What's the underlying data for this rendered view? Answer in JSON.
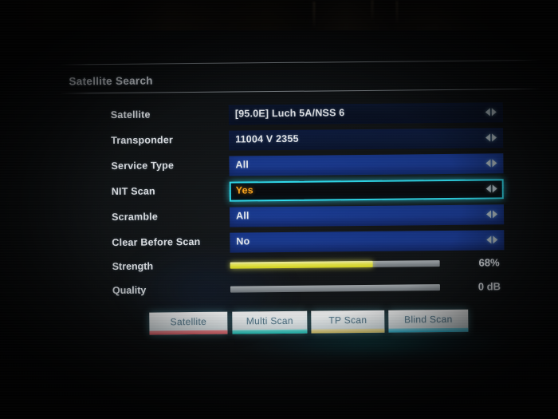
{
  "screen": {
    "title": "Satellite Search"
  },
  "fields": [
    {
      "label": "Satellite",
      "value": "[95.0E] Luch 5A/NSS 6",
      "selected": false,
      "shade": "dimmer"
    },
    {
      "label": "Transponder",
      "value": "11004 V 2355",
      "selected": false,
      "shade": "dim"
    },
    {
      "label": "Service Type",
      "value": "All",
      "selected": false,
      "shade": ""
    },
    {
      "label": "NIT Scan",
      "value": "Yes",
      "selected": true,
      "shade": ""
    },
    {
      "label": "Scramble",
      "value": "All",
      "selected": false,
      "shade": ""
    },
    {
      "label": "Clear Before Scan",
      "value": "No",
      "selected": false,
      "shade": ""
    }
  ],
  "meters": [
    {
      "label": "Strength",
      "value": "68%",
      "percent": 68
    },
    {
      "label": "Quality",
      "value": "0 dB",
      "percent": 0
    }
  ],
  "buttons": [
    {
      "label": "Satellite",
      "accent": "#f4626c"
    },
    {
      "label": "Multi Scan",
      "accent": "#1ad7cc"
    },
    {
      "label": "TP Scan",
      "accent": "#f2dd72"
    },
    {
      "label": "Blind Scan",
      "accent": "#2ec9ea"
    }
  ],
  "icons": {
    "left_arrow": "arrow-left-icon",
    "right_arrow": "arrow-right-icon"
  },
  "colors": {
    "field_blue": "#1a3a90",
    "highlight_border": "#31e0f2",
    "highlight_text": "#ffa81f",
    "meter_fill": "#f2f252",
    "meter_track": "#8f969b",
    "text": "#f0f3f7"
  }
}
